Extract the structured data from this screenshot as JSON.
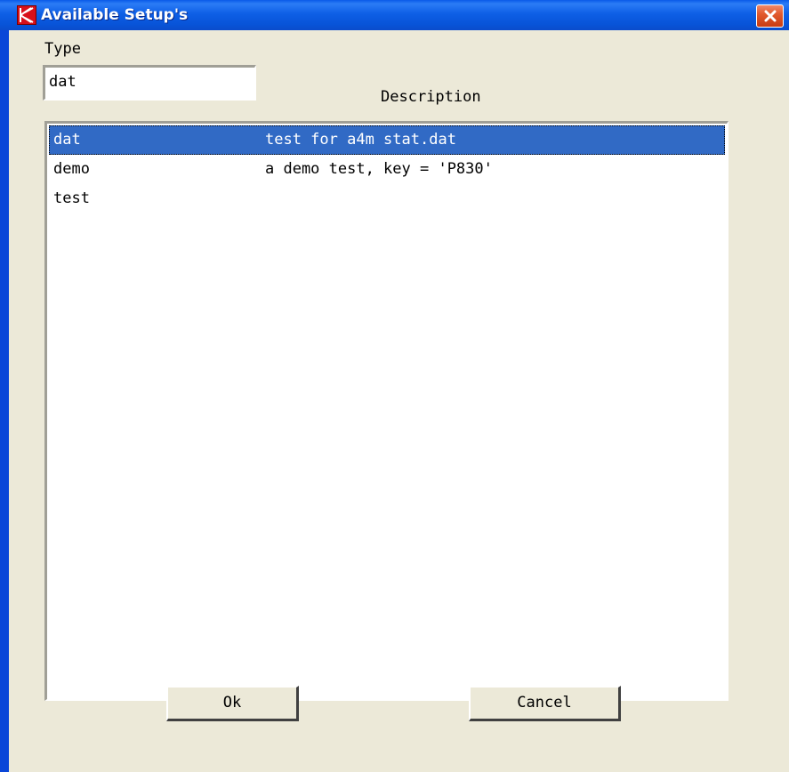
{
  "window": {
    "title": "Available Setup's",
    "icon": "k-app-icon",
    "close_icon": "close-icon"
  },
  "colors": {
    "titlebar": "#0a5ae8",
    "selection": "#316ac5",
    "dialog_bg": "#ece9d8",
    "close_button": "#e25a2e"
  },
  "form": {
    "type_label": "Type",
    "type_value": "dat",
    "description_header": "Description"
  },
  "list": {
    "items": [
      {
        "type": "dat",
        "description": "test for a4m stat.dat",
        "selected": true
      },
      {
        "type": "demo",
        "description": "a demo test, key = 'P830'",
        "selected": false
      },
      {
        "type": "test",
        "description": "",
        "selected": false
      }
    ]
  },
  "buttons": {
    "ok_label": "Ok",
    "cancel_label": "Cancel"
  }
}
